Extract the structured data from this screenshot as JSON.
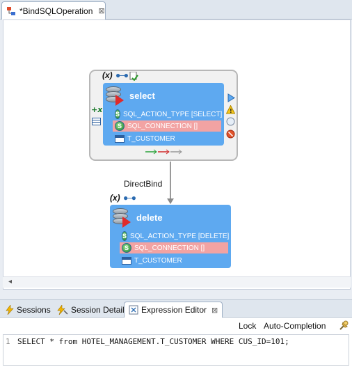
{
  "editor": {
    "tab_title": "*BindSQLOperation",
    "close_glyph": "⊠"
  },
  "canvas": {
    "connector_label": "DirectBind",
    "scroll_left_glyph": "◂",
    "x_badge": "(x)",
    "select_node": {
      "title": "select",
      "props": [
        {
          "icon": "S",
          "label": "SQL_ACTION_TYPE [SELECT]"
        },
        {
          "icon": "S",
          "label": "SQL_CONNECTION []",
          "error": true
        },
        {
          "icon": "table",
          "label": "T_CUSTOMER"
        }
      ]
    },
    "delete_node": {
      "title": "delete",
      "props": [
        {
          "icon": "S",
          "label": "SQL_ACTION_TYPE [DELETE]"
        },
        {
          "icon": "S",
          "label": "SQL_CONNECTION []",
          "error": true
        },
        {
          "icon": "table",
          "label": "T_CUSTOMER"
        }
      ]
    }
  },
  "bottom_panel": {
    "tabs": [
      {
        "label": "Sessions",
        "icon": "lightning-icon"
      },
      {
        "label": "Session Detail",
        "icon": "lightning-tools-icon"
      },
      {
        "label": "Expression Editor",
        "icon": "expression-icon",
        "active": true
      }
    ],
    "close_glyph": "⊠",
    "toolbar": {
      "lock_label": "Lock",
      "autocompletion_label": "Auto-Completion"
    },
    "code": {
      "line_number": "1",
      "text": "SELECT * from HOTEL_MANAGEMENT.T_CUSTOMER WHERE CUS_ID=101;"
    }
  },
  "colors": {
    "node_blue": "#5ea9f0",
    "error_row": "#f2a3a3",
    "group_bg": "#f1f1f1"
  }
}
